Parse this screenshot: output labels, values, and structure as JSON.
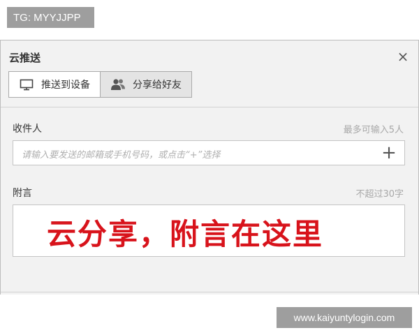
{
  "watermarks": {
    "top_left": "TG: MYYJJPP",
    "bottom_right": "www.kaiyuntylogin.com"
  },
  "dialog": {
    "title": "云推送",
    "close_icon": "close-icon"
  },
  "tabs": [
    {
      "label": "推送到设备",
      "icon": "monitor-icon",
      "active": true
    },
    {
      "label": "分享给好友",
      "icon": "users-icon",
      "active": false
    }
  ],
  "recipient": {
    "label": "收件人",
    "hint": "最多可输入5人",
    "placeholder": "请输入要发送的邮箱或手机号码，或点击“+”选择",
    "add_icon": "plus-icon"
  },
  "message": {
    "label": "附言",
    "hint": "不超过30字",
    "value": "云分享，附言在这里"
  },
  "colors": {
    "annotation_red": "#d8131b",
    "dialog_bg": "#f2f2f2",
    "watermark_bg": "#9e9e9e"
  }
}
